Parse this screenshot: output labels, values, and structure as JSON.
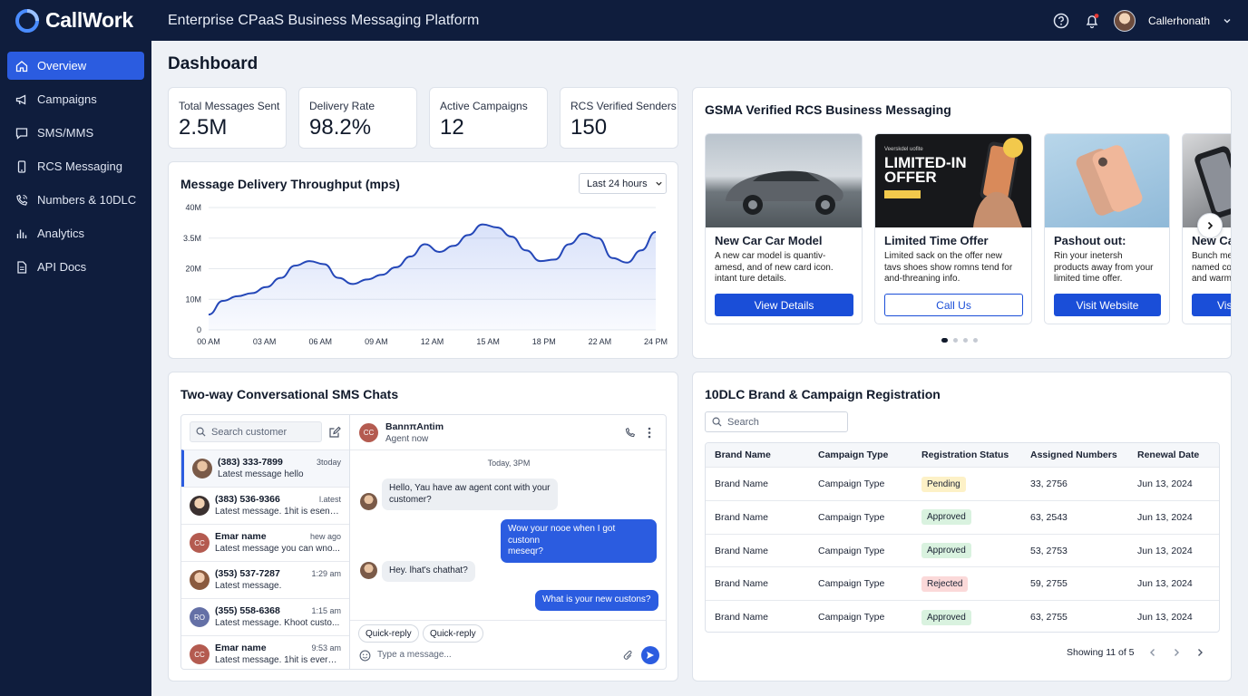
{
  "app": {
    "brand": "CallWork",
    "title": "Enterprise CPaaS Business Messaging Platform",
    "user": "Callerhonath",
    "colors": {
      "nav_bg": "#0f1d3d",
      "accent": "#2b5ce0"
    }
  },
  "topbar": {
    "icons": [
      "help-icon",
      "bell-icon",
      "chevron-down-icon"
    ]
  },
  "sidebar": {
    "items": [
      {
        "label": "Overview",
        "icon": "home-icon",
        "active": true
      },
      {
        "label": "Campaigns",
        "icon": "megaphone-icon"
      },
      {
        "label": "SMS/MMS",
        "icon": "message-icon"
      },
      {
        "label": "RCS Messaging",
        "icon": "phone-icon"
      },
      {
        "label": "Numbers & 10DLC",
        "icon": "phone-call-icon"
      },
      {
        "label": "Analytics",
        "icon": "bar-chart-icon"
      },
      {
        "label": "API Docs",
        "icon": "document-icon"
      }
    ]
  },
  "page": {
    "title": "Dashboard"
  },
  "stats": [
    {
      "label": "Total Messages Sent",
      "value": "2.5M"
    },
    {
      "label": "Delivery Rate",
      "value": "98.2%"
    },
    {
      "label": "Active Campaigns",
      "value": "12"
    },
    {
      "label": "RCS Verified Senders",
      "value": "150"
    }
  ],
  "throughput": {
    "title": "Message Delivery Throughput (mps)",
    "range": "Last 24 hours"
  },
  "chart_data": {
    "type": "area",
    "title": "Message Delivery Throughput (mps)",
    "y_ticks": [
      "40M",
      "3.5M",
      "20M",
      "10M",
      "0"
    ],
    "x_ticks": [
      "00 AM",
      "03 AM",
      "06 AM",
      "09 AM",
      "12 AM",
      "15 AM",
      "18 PM",
      "22 AM",
      "24 PM"
    ],
    "ylim": [
      0,
      40
    ],
    "grid": true,
    "series": [
      {
        "values": [
          5,
          9.5,
          11,
          12,
          14,
          17,
          21,
          22.5,
          21.5,
          17,
          15,
          16.5,
          18,
          20.5,
          24,
          28,
          25.5,
          27.5,
          31,
          34.5,
          33.5,
          30.5,
          26,
          22.5,
          23,
          28,
          31.5,
          30,
          23.5,
          22,
          26,
          32
        ]
      }
    ]
  },
  "rcs": {
    "title": "GSMA Verified RCS Business Messaging",
    "cards": [
      {
        "title": "New Car Car Model",
        "desc": [
          "A new car model is quantiv-",
          "amesd, and of new card icon.",
          "intant ture details."
        ],
        "button": "View Details",
        "image": "car-photo"
      },
      {
        "title": "Limited Time Offer",
        "desc": [
          "Limited sack on the offer new",
          "tavs shoes show romns tend for",
          "and-threaning info."
        ],
        "button": "Call Us",
        "image": "phone-offer-banner",
        "banner": [
          "LIMITED-IN",
          "OFFER"
        ],
        "banner_small": "Veerskdel uofite"
      },
      {
        "title": "Pashout out:",
        "desc": [
          "Rin your inetersh",
          "products away from your",
          "limited time offer."
        ],
        "button": "Visit Website",
        "image": "phone-product-photo"
      },
      {
        "title": "New Ca",
        "desc": [
          "Bunch me",
          "named co",
          "and warm"
        ],
        "button": "Vis",
        "image": "phone-in-hand-photo"
      }
    ],
    "pager": 4
  },
  "chat": {
    "title": "Two-way Conversational SMS Chats",
    "search_placeholder": "Search customer",
    "contacts": [
      {
        "name": "(383) 333-7899",
        "msg": "Latest message hello",
        "time": "3today",
        "avatar": "photo",
        "active": true
      },
      {
        "name": "(383) 536-9366",
        "msg": "Latest message. 1hit is esens ...",
        "time": "l.atest",
        "avatar": "photo"
      },
      {
        "name": "Emar name",
        "msg": "Latest message you can wno...",
        "time": "hew ago",
        "avatar": "CC",
        "color": "#b45b50"
      },
      {
        "name": "(353) 537-7287",
        "msg": "Latest message.",
        "time": "1:29 am",
        "avatar": "photo"
      },
      {
        "name": "(355) 558-6368",
        "msg": "Latest message. Khoot custo...",
        "time": "1:15 am",
        "avatar": "RO",
        "color": "#6470a6"
      },
      {
        "name": "Emar name",
        "msg": "Latest message. 1hit is evern...",
        "time": "9:53 am",
        "avatar": "CC",
        "color": "#b45b50"
      }
    ],
    "header": {
      "name": "BannπAntim",
      "status": "Agent now",
      "avatar": "CC"
    },
    "day": "Today, 3PM",
    "messages": [
      {
        "dir": "in",
        "lines": [
          "Hello, Yau have aw agent cont with your",
          "customer?"
        ]
      },
      {
        "dir": "out",
        "lines": [
          "Wow your nooe when I got custonn",
          "meseqr?"
        ]
      },
      {
        "dir": "in",
        "lines": [
          "Hey. lhat's chathat?"
        ]
      },
      {
        "dir": "out",
        "lines": [
          "What is your new custons?"
        ]
      }
    ],
    "quick_replies": [
      "Quick-reply",
      "Quick-reply"
    ],
    "input_placeholder": "Type a message..."
  },
  "registration": {
    "title": "10DLC Brand & Campaign Registration",
    "search_placeholder": "Search",
    "columns": [
      "Brand Name",
      "Campaign Type",
      "Registration Status",
      "Assigned Numbers",
      "Renewal Date"
    ],
    "rows": [
      {
        "brand": "Brand Name",
        "campaign": "Campaign Type",
        "status": "Pending",
        "numbers": "33, 2756",
        "renewal": "Jun 13, 2024"
      },
      {
        "brand": "Brand Name",
        "campaign": "Campaign Type",
        "status": "Approved",
        "numbers": "63, 2543",
        "renewal": "Jun 13, 2024"
      },
      {
        "brand": "Brand Name",
        "campaign": "Campaign Type",
        "status": "Approved",
        "numbers": "53, 2753",
        "renewal": "Jun 13, 2024"
      },
      {
        "brand": "Brand Name",
        "campaign": "Campaign Type",
        "status": "Rejected",
        "numbers": "59, 2755",
        "renewal": "Jun 13, 2024"
      },
      {
        "brand": "Brand Name",
        "campaign": "Campaign Type",
        "status": "Approved",
        "numbers": "63, 2755",
        "renewal": "Jun 13, 2024"
      }
    ],
    "footer": "Showing 11 of 5",
    "status_colors": {
      "Pending": "#fdf1c7",
      "Approved": "#d9f2df",
      "Rejected": "#fbd9d9"
    }
  }
}
